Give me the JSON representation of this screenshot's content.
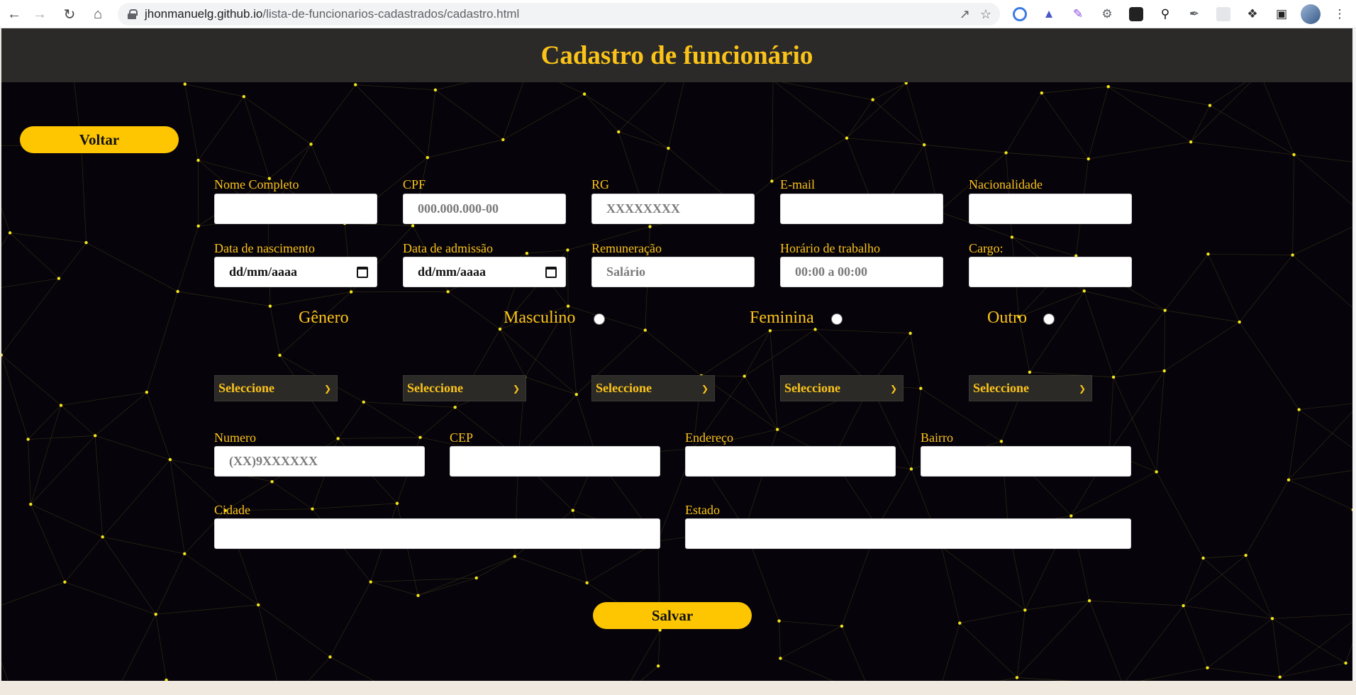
{
  "browser": {
    "url_host": "jhonmanuelg.github.io",
    "url_path": "/lista-de-funcionarios-cadastrados/cadastro.html"
  },
  "header": {
    "title": "Cadastro de funcionário"
  },
  "back_button": {
    "label": "Voltar"
  },
  "row1": [
    {
      "label": "Nome Completo",
      "placeholder": "",
      "value": ""
    },
    {
      "label": "CPF",
      "placeholder": "000.000.000-00",
      "value": ""
    },
    {
      "label": "RG",
      "placeholder": "XXXXXXXX",
      "value": ""
    },
    {
      "label": "E-mail",
      "placeholder": "",
      "value": ""
    },
    {
      "label": "Nacionalidade",
      "placeholder": "",
      "value": ""
    }
  ],
  "row2": [
    {
      "label": "Data de nascimento",
      "value": "dd/mm/aaaa"
    },
    {
      "label": "Data de admissão",
      "value": "dd/mm/aaaa"
    },
    {
      "label": "Remuneração",
      "placeholder": "Salário"
    },
    {
      "label": "Horário de trabalho",
      "placeholder": "00:00 a 00:00"
    },
    {
      "label": "Cargo:",
      "placeholder": ""
    }
  ],
  "gender": {
    "label": "Gênero",
    "options": [
      "Masculino",
      "Feminina",
      "Outro"
    ]
  },
  "selects": [
    "Seleccione",
    "Seleccione",
    "Seleccione",
    "Seleccione",
    "Seleccione"
  ],
  "row4": [
    {
      "label": "Numero",
      "placeholder": "(XX)9XXXXXX"
    },
    {
      "label": "CEP",
      "placeholder": ""
    },
    {
      "label": "Endereço",
      "placeholder": ""
    },
    {
      "label": "Bairro",
      "placeholder": ""
    }
  ],
  "row5": [
    {
      "label": "Cidade",
      "placeholder": ""
    },
    {
      "label": "Estado",
      "placeholder": ""
    }
  ],
  "save_button": {
    "label": "Salvar"
  },
  "colors": {
    "accent": "#fbc319",
    "page_bg": "#06030a",
    "header_bg": "#2b2a28",
    "button": "#fdc600"
  }
}
